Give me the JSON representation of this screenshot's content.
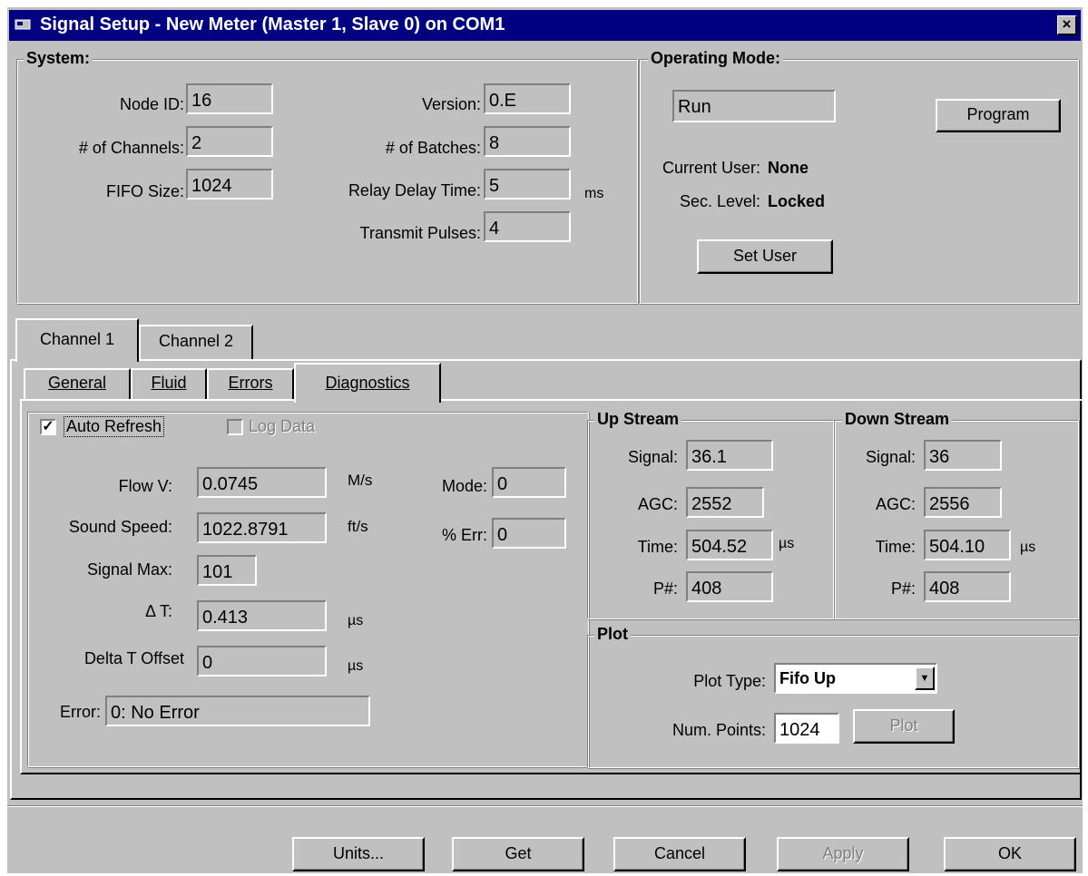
{
  "window": {
    "title": "Signal Setup - New Meter (Master 1, Slave 0) on COM1",
    "close": "×"
  },
  "system": {
    "label": "System:",
    "node_id_label": "Node ID:",
    "node_id": "16",
    "channels_label": "# of Channels:",
    "channels": "2",
    "fifo_label": "FIFO Size:",
    "fifo": "1024",
    "version_label": "Version:",
    "version": "0.E",
    "batches_label": "# of Batches:",
    "batches": "8",
    "relay_label": "Relay Delay Time:",
    "relay": "5",
    "relay_unit": "ms",
    "transmit_label": "Transmit Pulses:",
    "transmit": "4"
  },
  "operating": {
    "label": "Operating Mode:",
    "mode": "Run",
    "program_btn": "Program",
    "user_label": "Current User:",
    "user": "None",
    "sec_label": "Sec. Level:",
    "sec": "Locked",
    "set_user_btn": "Set User"
  },
  "channel_tabs": [
    "Channel 1",
    "Channel 2"
  ],
  "sub_tabs": [
    "General",
    "Fluid",
    "Errors",
    "Diagnostics"
  ],
  "diagnostics": {
    "auto_refresh": "Auto Refresh",
    "auto_refresh_checked": true,
    "check_mark": "✓",
    "log_data": "Log Data",
    "flowv_label": "Flow V:",
    "flowv": "0.0745",
    "flowv_unit": "M/s",
    "sound_label": "Sound Speed:",
    "sound": "1022.8791",
    "sound_unit": "ft/s",
    "sigmax_label": "Signal Max:",
    "sigmax": "101",
    "dt_label": "Δ T:",
    "dt": "0.413",
    "dt_unit": "µs",
    "dto_label": "Delta T Offset",
    "dto": "0",
    "dto_unit": "µs",
    "error_label": "Error:",
    "error": "0: No Error",
    "mode_label": "Mode:",
    "mode": "0",
    "err_label": "% Err:",
    "err": "0"
  },
  "upstream": {
    "label": "Up Stream",
    "signal_label": "Signal:",
    "signal": "36.1",
    "agc_label": "AGC:",
    "agc": "2552",
    "time_label": "Time:",
    "time": "504.52",
    "time_unit": "µs",
    "p_label": "P#:",
    "p": "408"
  },
  "downstream": {
    "label": "Down Stream",
    "signal_label": "Signal:",
    "signal": "36",
    "agc_label": "AGC:",
    "agc": "2556",
    "time_label": "Time:",
    "time": "504.10",
    "time_unit": "µs",
    "p_label": "P#:",
    "p": "408"
  },
  "plot": {
    "label": "Plot",
    "type_label": "Plot Type:",
    "type": "Fifo Up",
    "points_label": "Num. Points:",
    "points": "1024",
    "plot_btn": "Plot"
  },
  "buttons": {
    "units": "Units...",
    "get": "Get",
    "cancel": "Cancel",
    "apply": "Apply",
    "ok": "OK"
  }
}
